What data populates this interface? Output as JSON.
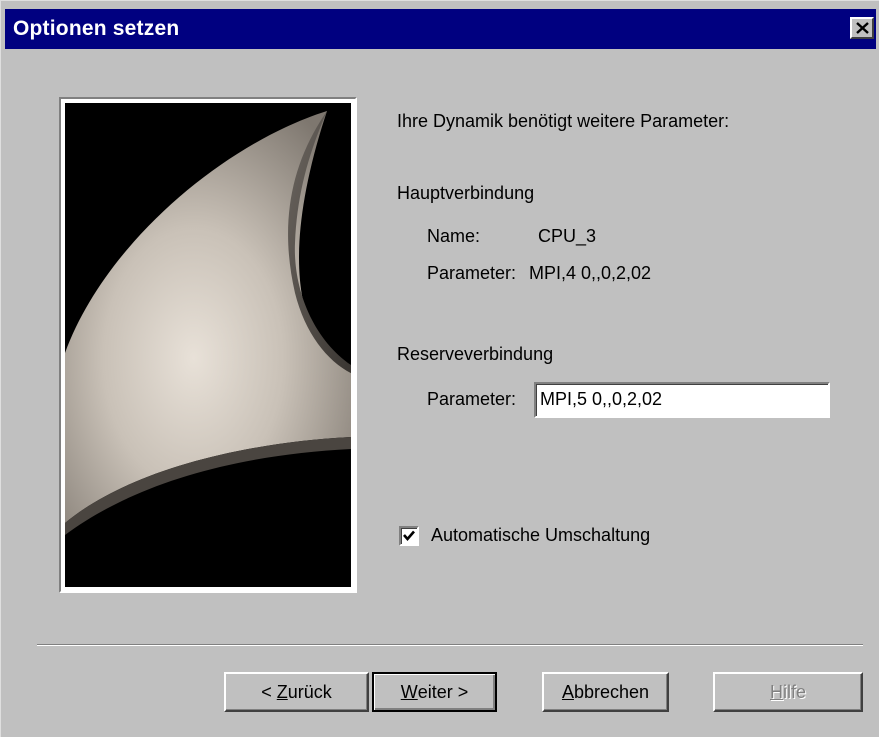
{
  "window": {
    "title": "Optionen setzen"
  },
  "intro_text": "Ihre Dynamik benötigt weitere Parameter:",
  "primary_connection": {
    "heading": "Hauptverbindung",
    "name_label": "Name:",
    "name_value": "CPU_3",
    "param_label": "Parameter:",
    "param_value": "MPI,4 0,,0,2,02"
  },
  "backup_connection": {
    "heading": "Reserveverbindung",
    "param_label": "Parameter:",
    "param_value": "MPI,5 0,,0,2,02"
  },
  "auto_switch": {
    "label": "Automatische Umschaltung",
    "checked": true
  },
  "buttons": {
    "back_prefix": "< ",
    "back_mnemonic": "Z",
    "back_rest": "urück",
    "next_mnemonic": "W",
    "next_rest": "eiter >",
    "cancel_mnemonic": "A",
    "cancel_rest": "bbrechen",
    "help_mnemonic": "H",
    "help_rest": "ilfe"
  },
  "colors": {
    "titlebar": "#000080",
    "dialog": "#c0c0c0"
  },
  "icons": [
    "close-icon",
    "checkmark-icon"
  ]
}
